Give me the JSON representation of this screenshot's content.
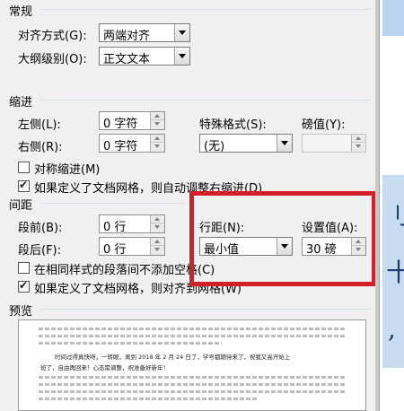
{
  "general": {
    "title": "常规",
    "alignment_label": "对齐方式(G):",
    "alignment_value": "两端对齐",
    "outline_label": "大纲级别(O):",
    "outline_value": "正文文本"
  },
  "indent": {
    "title": "缩进",
    "left_label": "左侧(L):",
    "left_value": "0 字符",
    "right_label": "右侧(R):",
    "right_value": "0 字符",
    "special_label": "特殊格式(S):",
    "special_value": "(无)",
    "by_label": "磅值(Y):",
    "by_value": "",
    "mirror_label": "对称缩进(M)",
    "mirror_checked": false,
    "auto_adjust_label": "如果定义了文档网格，则自动调整右缩进(D)",
    "auto_adjust_checked": true
  },
  "spacing": {
    "title": "间距",
    "before_label": "段前(B):",
    "before_value": "0 行",
    "after_label": "段后(F):",
    "after_value": "0 行",
    "line_spacing_label": "行距(N):",
    "line_spacing_value": "最小值",
    "at_label": "设置值(A):",
    "at_value": "30 磅",
    "no_space_label": "在相同样式的段落间不添加空格(C)",
    "no_space_checked": false,
    "snap_grid_label": "如果定义了文档网格，则对齐到网格(W)",
    "snap_grid_checked": true
  },
  "preview": {
    "title": "预览",
    "text_line1": "时间过得真快呀，一转眼，离到 2018 年 2 月 24 日了，学号都期待来了，祝我又高开始上",
    "text_line2": "班了，自由再回来！心态需调整，祝准备好新年！"
  },
  "colors": {
    "highlight_box": "#d51f27",
    "section_rule": "#d5dfe5",
    "background": "#f0f0f0"
  }
}
